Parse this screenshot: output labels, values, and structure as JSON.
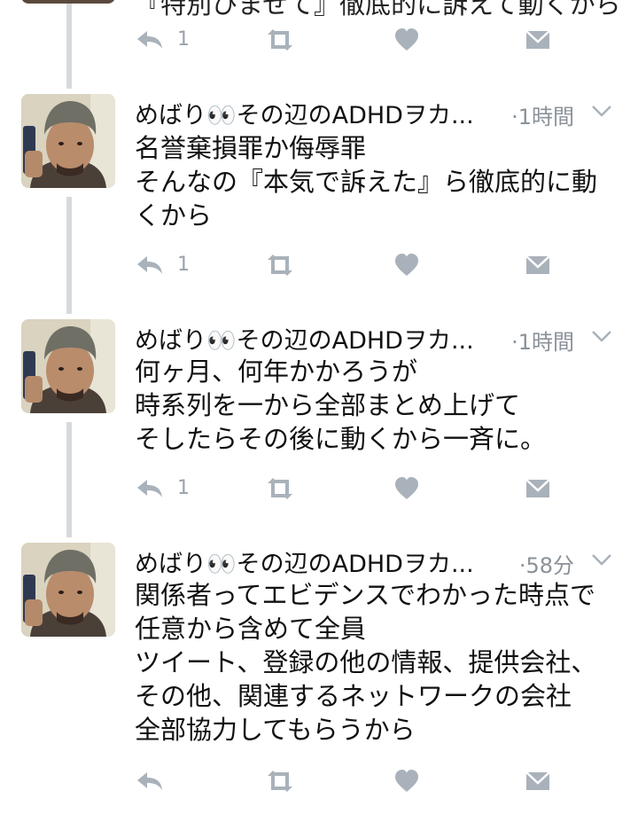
{
  "top_partial": {
    "text": "『特別ひませて』徹底的に訴えて動くから"
  },
  "tweets": [
    {
      "name": "めばり👀その辺のADHDヲカ...",
      "time": "·1時間",
      "lines": [
        "名誉棄損罪か侮辱罪",
        "そんなの『本気で訴えた』ら徹底的に動",
        "くから"
      ],
      "reply_count": "1"
    },
    {
      "name": "めばり👀その辺のADHDヲカ...",
      "time": "·1時間",
      "lines": [
        "何ヶ月、何年かかろうが",
        "時系列を一から全部まとめ上げて",
        "そしたらその後に動くから一斉に。"
      ],
      "reply_count": "1"
    },
    {
      "name": "めばり👀その辺のADHDヲカ...",
      "time": "·58分",
      "lines": [
        "関係者ってエビデンスでわかった時点で",
        "任意から含めて全員",
        "ツイート、登録の他の情報、提供会社、",
        "その他、関連するネットワークの会社",
        "全部協力してもらうから"
      ],
      "reply_count": ""
    }
  ],
  "top_reply_count": "1",
  "colors": {
    "icon": "#a9b2ba",
    "thread_line": "#d6dadd",
    "time": "#8a9198"
  },
  "icons": [
    "reply-icon",
    "retweet-icon",
    "like-icon",
    "direct-message-icon",
    "chevron-down-icon"
  ]
}
